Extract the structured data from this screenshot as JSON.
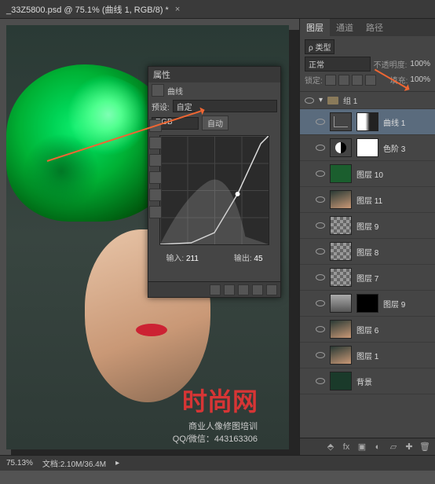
{
  "titlebar": {
    "doc_title": "_33Z5800.psd @ 75.1% (曲线 1, RGB/8) *",
    "close": "×"
  },
  "curves": {
    "panel_title": "属性",
    "type_label": "曲线",
    "preset_label": "预设:",
    "preset_value": "自定",
    "channel_value": "RGB",
    "auto_btn": "自动",
    "input_label": "输入:",
    "input_value": "211",
    "output_label": "输出:",
    "output_value": "45"
  },
  "watermark": {
    "main": "时尚网",
    "sub": "商业人像修图培训",
    "qq": "QQ/微信：443163306"
  },
  "layers_panel": {
    "tabs": [
      "图层",
      "通道",
      "路径"
    ],
    "kind_label": "ρ 类型",
    "blend_mode": "正常",
    "opacity_label": "不透明度:",
    "opacity_value": "100%",
    "lock_label": "锁定:",
    "fill_label": "填充:",
    "fill_value": "100%",
    "group_name": "组 1",
    "layers": [
      {
        "name": "曲线 1",
        "thumb": "curves",
        "mask": "gray",
        "selected": true
      },
      {
        "name": "色阶 3",
        "thumb": "adj",
        "mask": "white"
      },
      {
        "name": "图层 10",
        "thumb": "green",
        "mask": null
      },
      {
        "name": "图层 11",
        "thumb": "photo",
        "mask": null
      },
      {
        "name": "图层 9",
        "thumb": "trans",
        "mask": null
      },
      {
        "name": "图层 8",
        "thumb": "trans",
        "mask": null
      },
      {
        "name": "图层 7",
        "thumb": "trans",
        "mask": null
      },
      {
        "name": "图层 9",
        "thumb": "gray",
        "mask": "black"
      },
      {
        "name": "图层 6",
        "thumb": "photo",
        "mask": null
      },
      {
        "name": "图层 1",
        "thumb": "photo",
        "mask": null
      },
      {
        "name": "背景",
        "thumb": "bg",
        "mask": null
      }
    ]
  },
  "statusbar": {
    "zoom": "75.13%",
    "doc_info": "文档:2.10M/36.4M"
  }
}
